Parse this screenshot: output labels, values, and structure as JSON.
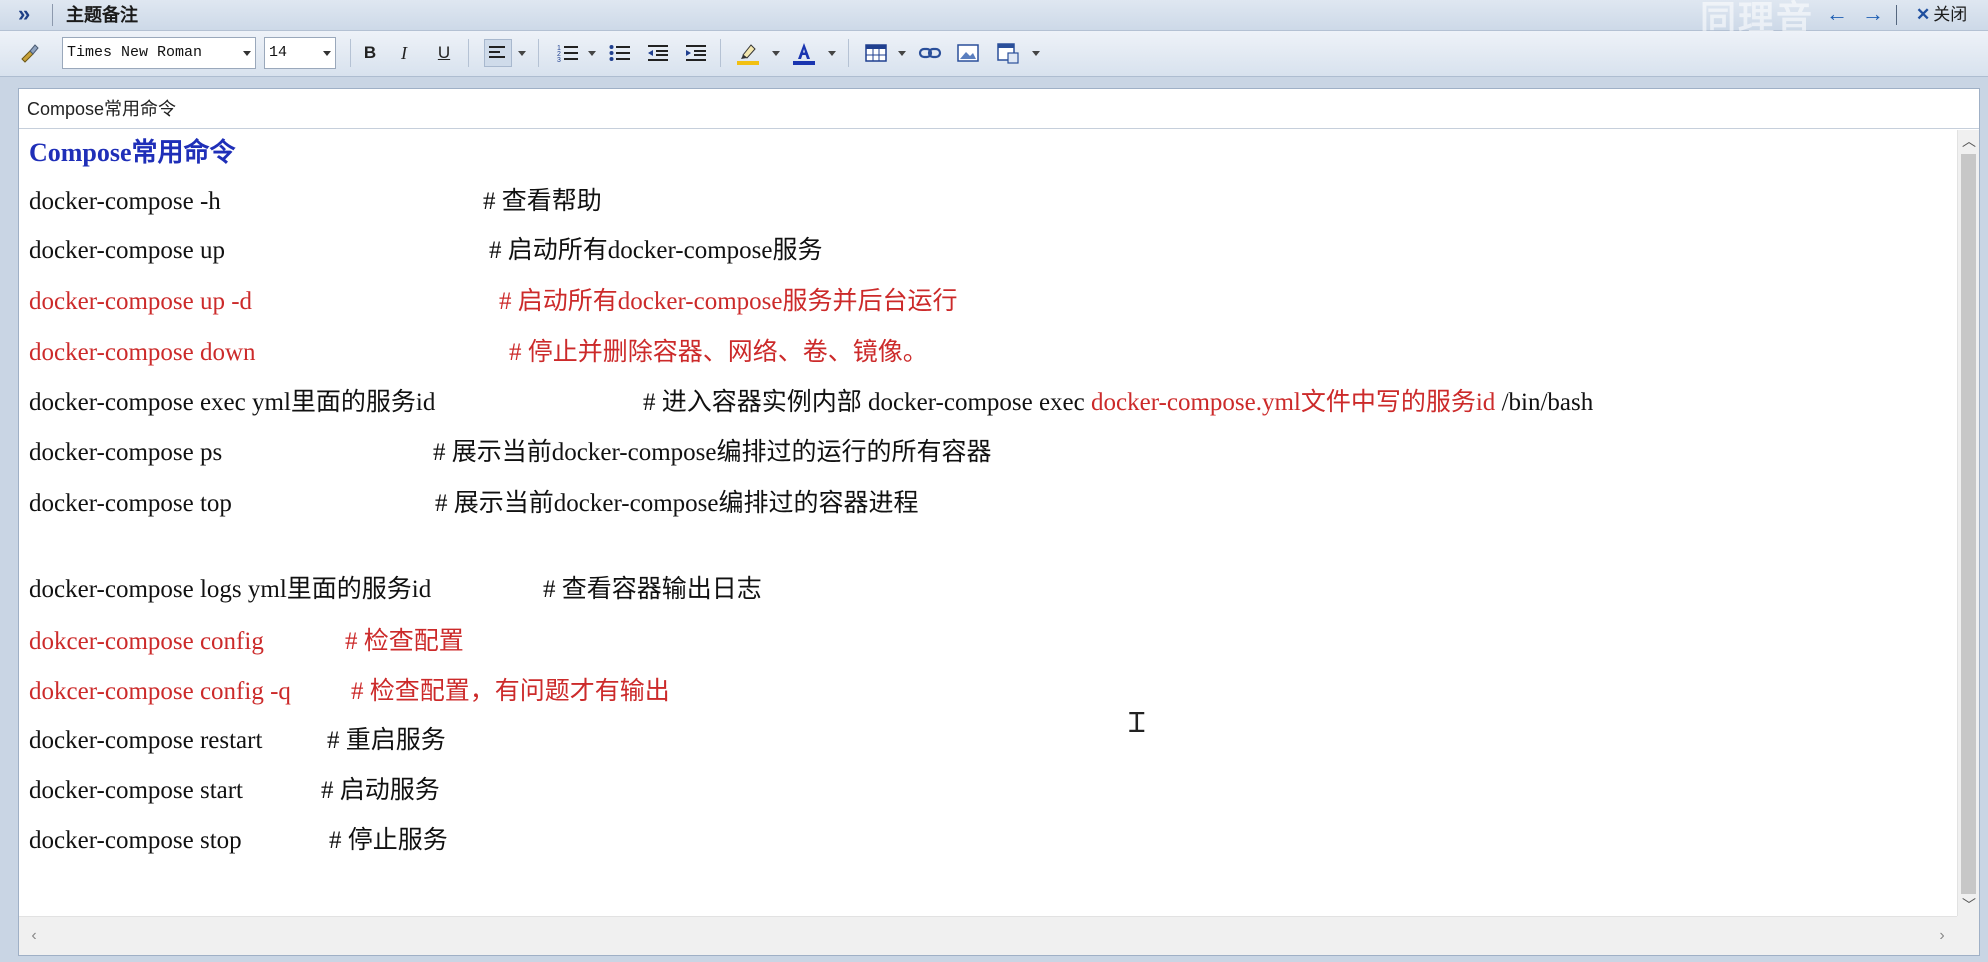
{
  "titlebar": {
    "expand_glyph": "»",
    "title": "主题备注",
    "watermark": "同理音",
    "back_glyph": "←",
    "forward_glyph": "→",
    "close_glyph": "✕",
    "close_label": "关闭"
  },
  "toolbar": {
    "font_family": "Times New Roman",
    "font_size": "14",
    "bold_label": "B",
    "italic_label": "I",
    "underline_label": "U",
    "icons": [
      "clear-format-icon",
      "align-left-icon",
      "numbered-list-icon",
      "bullet-list-icon",
      "outdent-icon",
      "indent-icon",
      "highlight-color-icon",
      "font-color-icon",
      "table-icon",
      "link-icon",
      "image-icon",
      "insert-object-icon"
    ],
    "highlight_color": "#f2c012",
    "font_color": "#1a35b0"
  },
  "subject": "Compose常用命令",
  "content": {
    "heading": "Compose常用命令",
    "lines": [
      {
        "cmd": "docker-compose -h",
        "comment": "# 查看帮助"
      },
      {
        "cmd": "docker-compose up",
        "comment": "# 启动所有docker-compose服务"
      },
      {
        "cmd": "docker-compose up -d",
        "comment": "# 启动所有docker-compose服务并后台运行"
      },
      {
        "cmd": "docker-compose down",
        "comment": "# 停止并删除容器、网络、卷、镜像。"
      },
      {
        "cmd": "docker-compose exec  yml里面的服务id",
        "comment": "# 进入容器实例内部  docker-compose exec ",
        "comment_red": "docker-compose.yml文件中写的服务id",
        "comment_tail": " /bin/bash"
      },
      {
        "cmd": "docker-compose ps",
        "comment": "# 展示当前docker-compose编排过的运行的所有容器"
      },
      {
        "cmd": "docker-compose top",
        "comment": "# 展示当前docker-compose编排过的容器进程"
      },
      {
        "cmd": "docker-compose logs  yml里面的服务id",
        "comment": "# 查看容器输出日志"
      },
      {
        "cmd": "dokcer-compose config",
        "comment": "# 检查配置"
      },
      {
        "cmd": "dokcer-compose config -q",
        "comment": "# 检查配置，有问题才有输出"
      },
      {
        "cmd": "docker-compose restart",
        "comment": "# 重启服务"
      },
      {
        "cmd": "docker-compose start",
        "comment": "# 启动服务"
      },
      {
        "cmd": "docker-compose stop",
        "comment": "# 停止服务"
      }
    ]
  },
  "colors": {
    "heading": "#1f2fb8",
    "emphasis_red": "#cc2a2a",
    "normal_text": "#111111"
  }
}
